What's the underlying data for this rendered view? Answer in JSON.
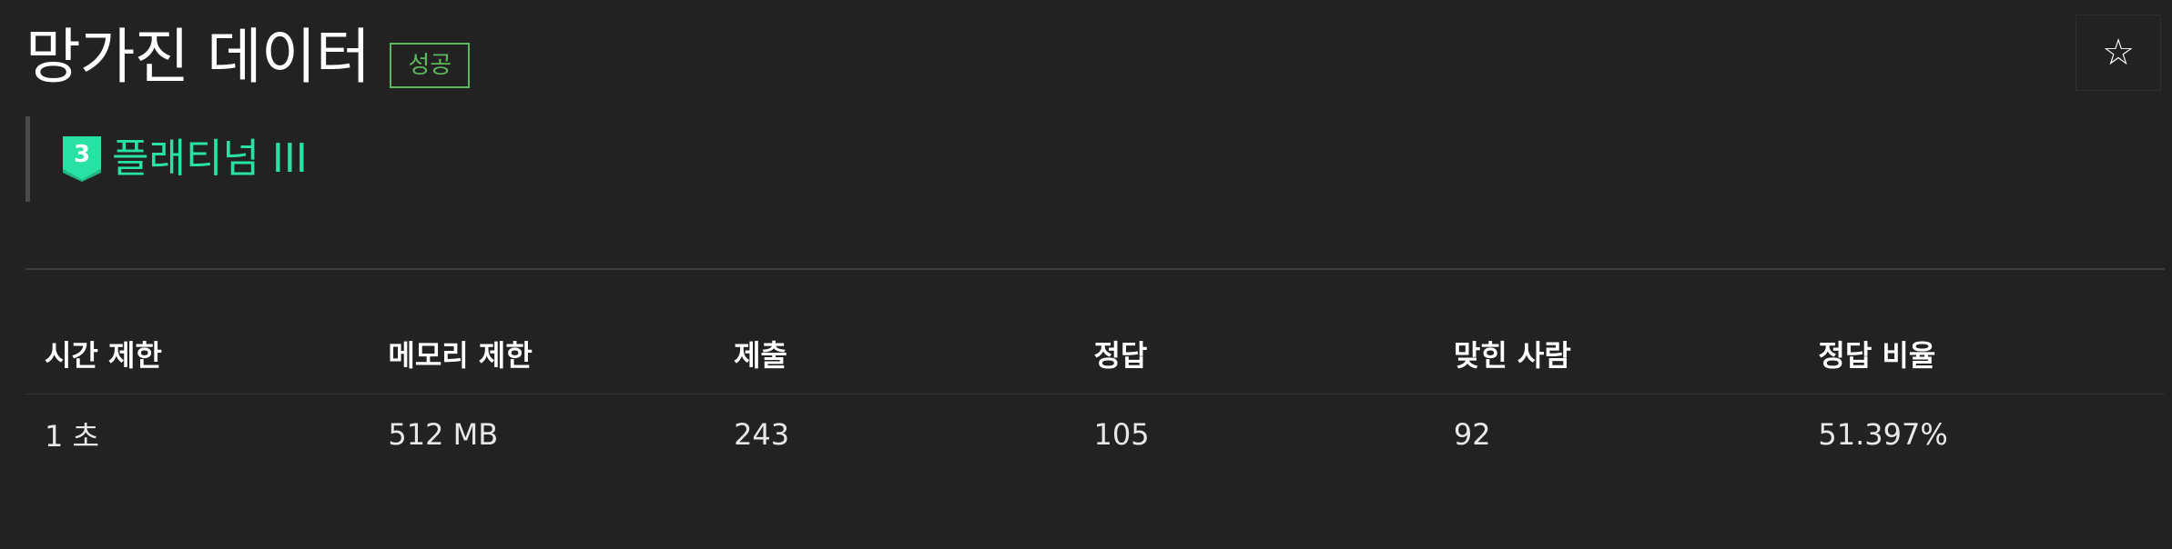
{
  "problem": {
    "title": "망가진 데이터",
    "status_badge": "성공",
    "tier": {
      "number": "3",
      "label": "플래티넘 III",
      "color": "#27e2a4"
    },
    "star_icon": "star-outline-icon"
  },
  "stats": {
    "headers": [
      "시간 제한",
      "메모리 제한",
      "제출",
      "정답",
      "맞힌 사람",
      "정답 비율"
    ],
    "values": [
      "1 초",
      "512 MB",
      "243",
      "105",
      "92",
      "51.397%"
    ]
  },
  "colors": {
    "background": "#222222",
    "success": "#5cb85c",
    "platinum": "#27e2a4"
  }
}
